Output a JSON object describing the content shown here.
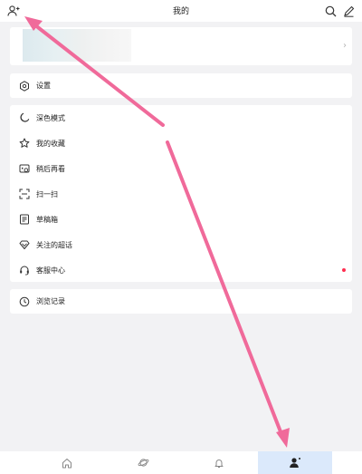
{
  "header": {
    "title": "我的",
    "left_icon": "add-friend-icon",
    "right_icons": [
      "search-icon",
      "edit-icon"
    ]
  },
  "profile": {
    "chevron": "›"
  },
  "settings": {
    "label": "设置",
    "icon": "gear-icon"
  },
  "menu": {
    "items": [
      {
        "label": "深色模式",
        "icon": "moon-icon"
      },
      {
        "label": "我的收藏",
        "icon": "star-icon"
      },
      {
        "label": "稍后再看",
        "icon": "watch-later-icon"
      },
      {
        "label": "扫一扫",
        "icon": "scan-icon"
      },
      {
        "label": "草稿箱",
        "icon": "drafts-icon"
      },
      {
        "label": "关注的超话",
        "icon": "super-topic-icon"
      },
      {
        "label": "客服中心",
        "icon": "headset-icon"
      }
    ]
  },
  "history": {
    "label": "浏览记录",
    "icon": "clock-icon"
  },
  "tabs": [
    {
      "name": "home",
      "icon": "home-icon"
    },
    {
      "name": "discover",
      "icon": "planet-icon"
    },
    {
      "name": "messages",
      "icon": "bell-icon"
    },
    {
      "name": "profile",
      "icon": "person-icon",
      "active": true
    }
  ],
  "colors": {
    "background": "#f2f2f4",
    "card": "#ffffff",
    "active_tab": "#dbe9fb",
    "notification_dot": "#ff2d4f",
    "annotation_arrow": "#f06a9a"
  }
}
